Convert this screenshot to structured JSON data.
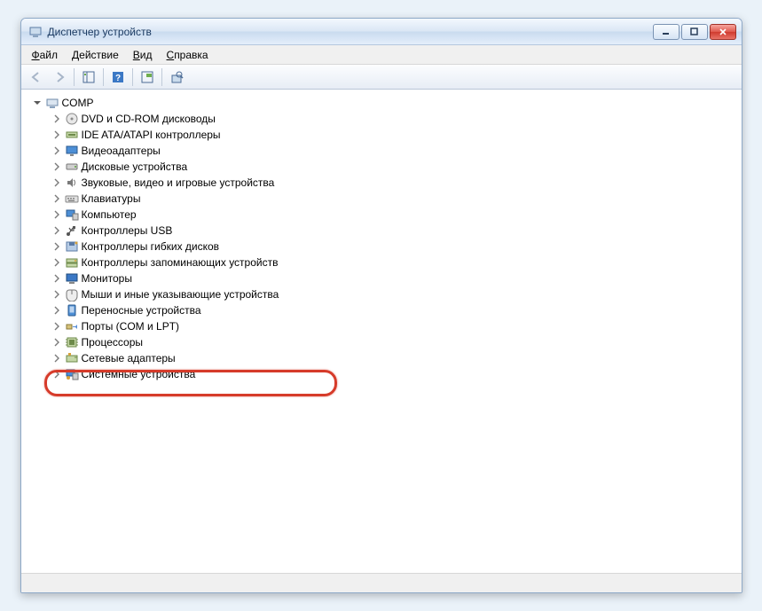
{
  "window": {
    "title": "Диспетчер устройств"
  },
  "menu": {
    "file": "Файл",
    "action": "Действие",
    "view": "Вид",
    "help": "Справка"
  },
  "tree": {
    "root": "COMP",
    "nodes": [
      {
        "label": "DVD и CD-ROM дисководы",
        "icon": "disc"
      },
      {
        "label": "IDE ATA/ATAPI контроллеры",
        "icon": "ide"
      },
      {
        "label": "Видеоадаптеры",
        "icon": "display"
      },
      {
        "label": "Дисковые устройства",
        "icon": "disk"
      },
      {
        "label": "Звуковые, видео и игровые устройства",
        "icon": "sound"
      },
      {
        "label": "Клавиатуры",
        "icon": "keyboard"
      },
      {
        "label": "Компьютер",
        "icon": "computer"
      },
      {
        "label": "Контроллеры USB",
        "icon": "usb"
      },
      {
        "label": "Контроллеры гибких дисков",
        "icon": "floppyctl"
      },
      {
        "label": "Контроллеры запоминающих устройств",
        "icon": "storage"
      },
      {
        "label": "Мониторы",
        "icon": "monitor"
      },
      {
        "label": "Мыши и иные указывающие устройства",
        "icon": "mouse",
        "highlighted": true
      },
      {
        "label": "Переносные устройства",
        "icon": "portable"
      },
      {
        "label": "Порты (COM и LPT)",
        "icon": "port"
      },
      {
        "label": "Процессоры",
        "icon": "cpu"
      },
      {
        "label": "Сетевые адаптеры",
        "icon": "network"
      },
      {
        "label": "Системные устройства",
        "icon": "system"
      }
    ]
  }
}
